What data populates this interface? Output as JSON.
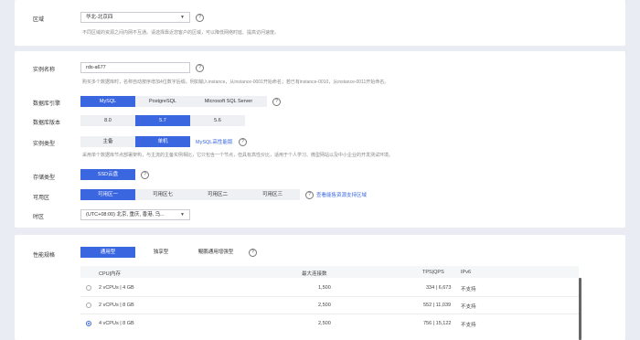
{
  "region": {
    "label": "区域",
    "value": "华北-北京四",
    "hint": "不同区域的资源之间内网不互通。请选择靠近您客户的区域，可以降低网络时延、提高访问速度。"
  },
  "instance_name": {
    "label": "实例名称",
    "value": "rds-a677",
    "hint": "购买多个数据库时，名称自动按序增加4位数字后缀。例如输入instance，从instance-0001开始命名；若已有instance-0010，从instance-0011开始命名。"
  },
  "engine": {
    "label": "数据库引擎",
    "options": [
      "MySQL",
      "PostgreSQL",
      "Microsoft SQL Server"
    ]
  },
  "version": {
    "label": "数据库版本",
    "options": [
      "8.0",
      "5.7",
      "5.6"
    ]
  },
  "instance_type": {
    "label": "实例类型",
    "options": [
      "主备",
      "单机"
    ],
    "link": "MySQL高性能版",
    "hint": "采用单个数据库节点部署架构，与主流的主备实例相比，它只包含一个节点，但具有高性价比，适用于个人学习、微型网站以及中小企业的开发测试环境。"
  },
  "storage": {
    "label": "存储类型",
    "option": "SSD云盘"
  },
  "az": {
    "label": "可用区",
    "options": [
      "可用区一",
      "可用区七",
      "可用区二",
      "可用区三"
    ],
    "link": "查看能售资源支持区域"
  },
  "timezone": {
    "label": "时区",
    "value": "(UTC+08:00) 北京, 重庆, 香港, 乌..."
  },
  "perf": {
    "label": "性能规格",
    "tabs": [
      "通用型",
      "独享型",
      "鲲鹏通用增强型"
    ],
    "headers": [
      "CPU|内存",
      "最大连接数",
      "TPS|QPS",
      "IPv6"
    ],
    "rows": [
      {
        "cpu": "2 vCPUs | 4 GB",
        "conn": "1,500",
        "tpsqps": "334 | 6,673",
        "ipv6": "不支持"
      },
      {
        "cpu": "2 vCPUs | 8 GB",
        "conn": "2,500",
        "tpsqps": "552 | 11,039",
        "ipv6": "不支持"
      },
      {
        "cpu": "4 vCPUs | 8 GB",
        "conn": "2,500",
        "tpsqps": "756 | 15,122",
        "ipv6": "不支持"
      }
    ],
    "selected_row": 2
  },
  "colors": {
    "accent": "#3a66e0",
    "background": "#e9ecf2"
  }
}
